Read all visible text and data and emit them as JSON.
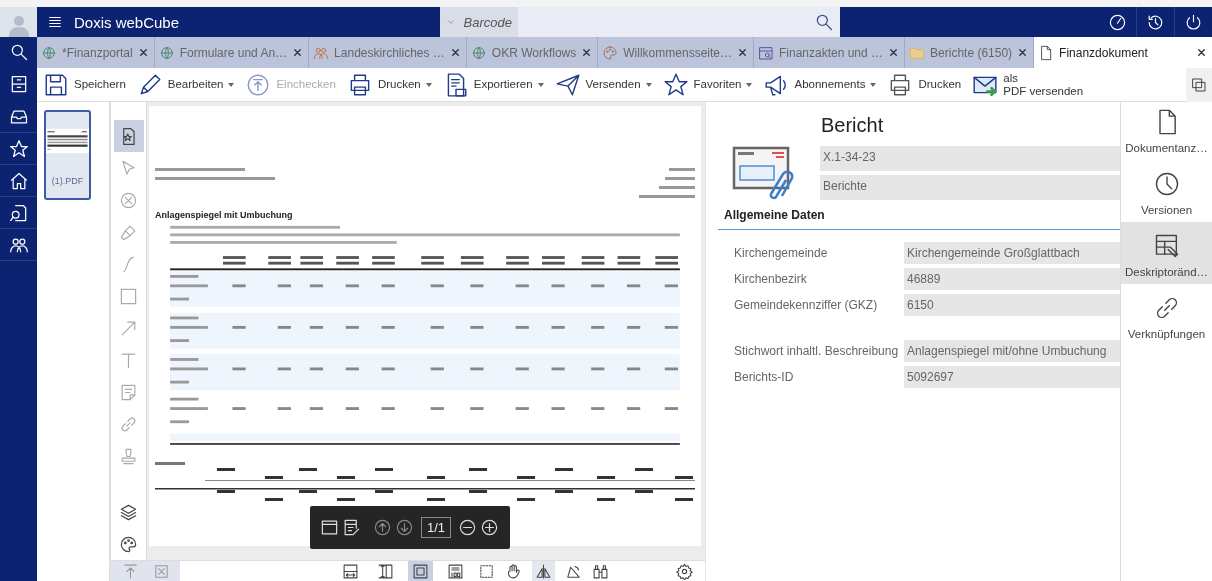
{
  "header": {
    "app_title": "Doxis webCube",
    "search_scope": "Barcode"
  },
  "tabs": [
    {
      "label": "*Finanzportal",
      "selected": false
    },
    {
      "label": "Formulare und An…",
      "selected": false
    },
    {
      "label": "Landeskirchliches …",
      "selected": false
    },
    {
      "label": "OKR Workflows",
      "selected": false
    },
    {
      "label": "Willkommensseite…",
      "selected": false
    },
    {
      "label": "Finanzakten und …",
      "selected": false
    },
    {
      "label": "Berichte (6150)",
      "selected": false
    },
    {
      "label": "Finanzdokument",
      "selected": true
    }
  ],
  "toolbar": [
    {
      "label": "Speichern",
      "dropdown": false,
      "disabled": false
    },
    {
      "label": "Bearbeiten",
      "dropdown": true,
      "disabled": false
    },
    {
      "label": "Einchecken",
      "dropdown": false,
      "disabled": true
    },
    {
      "label": "Drucken",
      "dropdown": true,
      "disabled": false
    },
    {
      "label": "Exportieren",
      "dropdown": true,
      "disabled": false
    },
    {
      "label": "Versenden",
      "dropdown": true,
      "disabled": false
    },
    {
      "label": "Favoriten",
      "dropdown": true,
      "disabled": false
    },
    {
      "label": "Abonnements",
      "dropdown": true,
      "disabled": false
    },
    {
      "label": "Drucken",
      "dropdown": false,
      "disabled": false
    },
    {
      "label": "als\nPDF versenden",
      "dropdown": false,
      "disabled": false
    }
  ],
  "thumbnail": {
    "label": "(1).PDF",
    "selected": true
  },
  "annotation_tools": [
    {
      "selected": true
    },
    {
      "selected": false
    },
    {
      "selected": false
    },
    {
      "selected": false
    },
    {
      "selected": false
    },
    {
      "selected": false
    },
    {
      "selected": false
    },
    {
      "selected": false
    },
    {
      "selected": false
    },
    {
      "selected": false
    },
    {
      "selected": false
    },
    {
      "selected": false
    },
    {
      "selected": false
    }
  ],
  "document": {
    "title": "Anlagenspiegel mit Umbuchung"
  },
  "page_nav": {
    "page": "1/1"
  },
  "zoom_modes": [
    {
      "selected": false
    },
    {
      "selected": false
    },
    {
      "selected": true
    },
    {
      "selected": false
    }
  ],
  "metadata": {
    "title": "Bericht",
    "header_fields": [
      "X.1-34-23",
      "Berichte"
    ],
    "section": "Allgemeine Daten",
    "field_groups": [
      [
        {
          "label": "Kirchengemeinde",
          "value": "Kirchengemeinde Großglattbach"
        },
        {
          "label": "Kirchenbezirk",
          "value": "46889"
        },
        {
          "label": "Gemeindekennziffer (GKZ)",
          "value": "6150"
        }
      ],
      [
        {
          "label": "Stichwort inhaltl. Beschreibung",
          "value": "Anlagenspiegel mit/ohne Umbuchung"
        },
        {
          "label": "Berichts-ID",
          "value": "5092697"
        }
      ]
    ]
  },
  "side_panel": [
    {
      "label": "Dokumentanz…",
      "selected": false
    },
    {
      "label": "Versionen",
      "selected": false
    },
    {
      "label": "Deskriptoränd…",
      "selected": true
    },
    {
      "label": "Verknüpfungen",
      "selected": false
    }
  ]
}
